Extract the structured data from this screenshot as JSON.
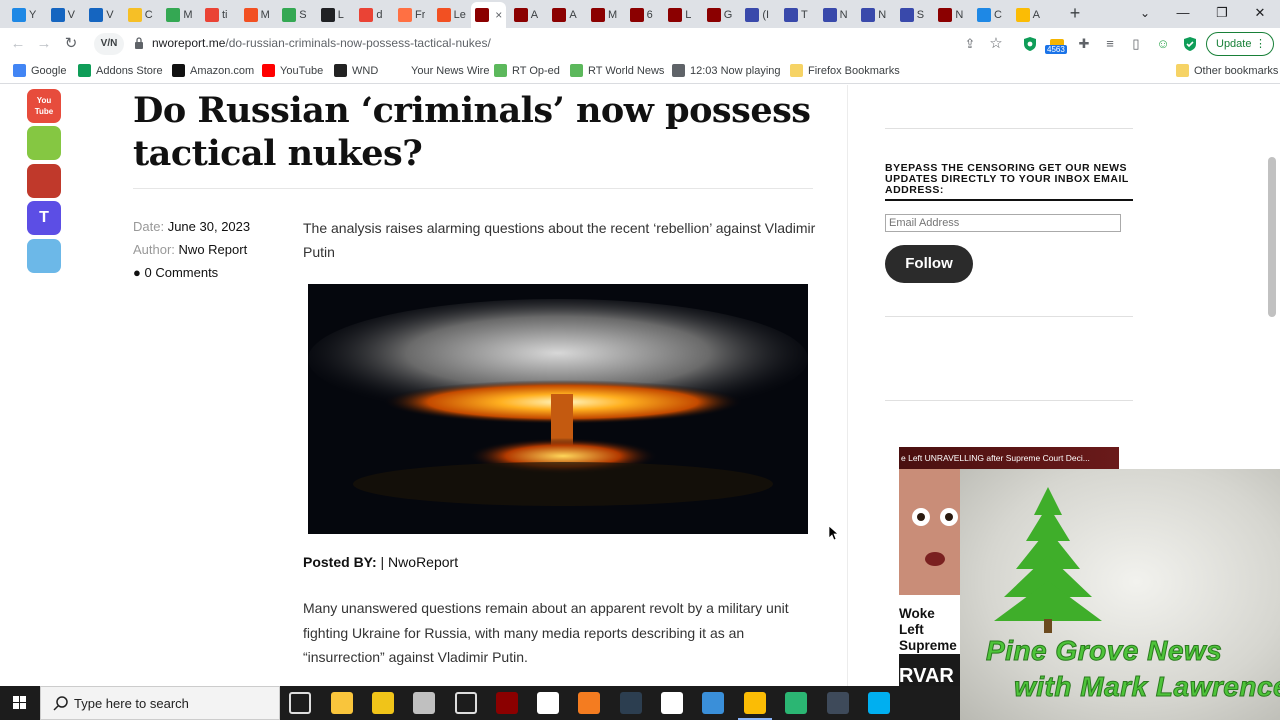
{
  "browser": {
    "tabs": [
      {
        "letter": "Y",
        "color": "#1e88e5"
      },
      {
        "letter": "V",
        "color": "#1565c0"
      },
      {
        "letter": "V",
        "color": "#1565c0"
      },
      {
        "letter": "C",
        "color": "#f6bf26"
      },
      {
        "letter": "M",
        "color": "#34a853"
      },
      {
        "letter": "ti",
        "color": "#ea4335"
      },
      {
        "letter": "M",
        "color": "#f25022"
      },
      {
        "letter": "S",
        "color": "#34a853"
      },
      {
        "letter": "L",
        "color": "#202124"
      },
      {
        "letter": "d",
        "color": "#ea4335"
      },
      {
        "letter": "Fr",
        "color": "#ff7043"
      },
      {
        "letter": "Le",
        "color": "#f25022"
      },
      {
        "letter": "",
        "color": "#8b0000",
        "active": true
      },
      {
        "letter": "A",
        "color": "#8b0000"
      },
      {
        "letter": "A",
        "color": "#8b0000"
      },
      {
        "letter": "M",
        "color": "#8b0000"
      },
      {
        "letter": "6",
        "color": "#8b0000"
      },
      {
        "letter": "L",
        "color": "#8b0000"
      },
      {
        "letter": "G",
        "color": "#8b0000"
      },
      {
        "letter": "(I",
        "color": "#3949ab"
      },
      {
        "letter": "T",
        "color": "#3949ab"
      },
      {
        "letter": "N",
        "color": "#3949ab"
      },
      {
        "letter": "N",
        "color": "#3949ab"
      },
      {
        "letter": "S",
        "color": "#3949ab"
      },
      {
        "letter": "N",
        "color": "#8b0000"
      },
      {
        "letter": "C",
        "color": "#1e88e5"
      },
      {
        "letter": "A",
        "color": "#fbbc05"
      }
    ],
    "active_tab_close": "×",
    "new_tab": "+",
    "window": {
      "chevron": "⌄",
      "minimize": "—",
      "restore": "❐",
      "close": "✕"
    },
    "url_domain": "nworeport.me",
    "url_path": "/do-russian-criminals-now-possess-tactical-nukes/",
    "site_info_label": "V/N",
    "extension_badge": "4563",
    "update_label": "Update",
    "update_menu": "⋮",
    "bookmarks": [
      {
        "label": "Google",
        "color": "#4285f4"
      },
      {
        "label": "Addons Store",
        "color": "#0f9d58"
      },
      {
        "label": "Amazon.com",
        "color": "#111111"
      },
      {
        "label": "YouTube",
        "color": "#ff0000"
      },
      {
        "label": "WND",
        "color": "#222222"
      },
      {
        "label": "Your News Wire",
        "color": "#ffffff"
      },
      {
        "label": "RT Op-ed",
        "color": "#5cb85c"
      },
      {
        "label": "RT World News",
        "color": "#5cb85c"
      },
      {
        "label": "12:03  Now playing",
        "color": "#5f6368"
      },
      {
        "label": "Firefox Bookmarks",
        "color": "#f6d365"
      }
    ],
    "other_bookmarks": "Other bookmarks",
    "icons": {
      "back": "←",
      "forward": "→",
      "reload": "↻",
      "share": "⇪",
      "star": "☆",
      "puzzle": "✚",
      "menu": "≡",
      "sidebar": "▯",
      "profile": "☺"
    }
  },
  "article": {
    "title": "Do Russian ‘criminals’ now possess tactical nukes?",
    "date_label": "Date:",
    "date": "June 30, 2023",
    "author_label": "Author:",
    "author": "Nwo Report",
    "comments": "0 Comments",
    "lede": "The analysis raises alarming questions about the recent ‘rebellion’ against Vladimir Putin",
    "posted_by_label": "Posted BY:",
    "posted_by": "| NwoReport",
    "body": "Many unanswered questions remain about an apparent revolt by a military unit fighting Ukraine for Russia, with many media reports describing it as an “insurrection” against Vladimir Putin."
  },
  "social": [
    {
      "name": "youtube",
      "color": "#e74c3c",
      "label": "You Tube"
    },
    {
      "name": "rumble",
      "color": "#85c742",
      "label": ""
    },
    {
      "name": "gab",
      "color": "#c0392b",
      "label": ""
    },
    {
      "name": "truth",
      "color": "#5c4ee5",
      "label": "T"
    },
    {
      "name": "telegram",
      "color": "#6cb8e8",
      "label": ""
    }
  ],
  "sidebar": {
    "newsletter_title": "BYEPASS THE CENSORING GET OUR NEWS UPDATES DIRECTLY TO YOUR INBOX EMAIL ADDRESS:",
    "email_placeholder": "Email Address",
    "follow_label": "Follow",
    "video_title": "e Left UNRAVELLING after Supreme Court Deci...",
    "video_caption": "Woke Left Supreme",
    "video2_text": "RVAR"
  },
  "overlay": {
    "line1": "Pine Grove News",
    "line2": "with Mark Lawrence"
  },
  "taskbar": {
    "search_placeholder": "Type here to search",
    "apps": [
      {
        "name": "task-view",
        "color": "#1c1c1c"
      },
      {
        "name": "file-explorer",
        "color": "#f9c53c"
      },
      {
        "name": "app-vpn",
        "color": "#f0c419"
      },
      {
        "name": "app-tools",
        "color": "#c0c0c0"
      },
      {
        "name": "settings",
        "color": "#1c1c1c"
      },
      {
        "name": "app-red",
        "color": "#8b0000"
      },
      {
        "name": "app-doc",
        "color": "#ffffff"
      },
      {
        "name": "app-orange",
        "color": "#f47c20"
      },
      {
        "name": "app-x",
        "color": "#2c3e50"
      },
      {
        "name": "app-dots",
        "color": "#ffffff"
      },
      {
        "name": "app-draw",
        "color": "#3a8fd9"
      },
      {
        "name": "chrome",
        "color": "#fbbc05",
        "active": true
      },
      {
        "name": "app-green",
        "color": "#2bb673"
      },
      {
        "name": "app-dark",
        "color": "#3e4a5a"
      },
      {
        "name": "skype",
        "color": "#00aff0"
      }
    ]
  },
  "colors": {
    "accent": "#1a73e8",
    "update_green": "#188038",
    "follow_bg": "#2b2b2b",
    "overlay_text": "#4ec43a"
  }
}
